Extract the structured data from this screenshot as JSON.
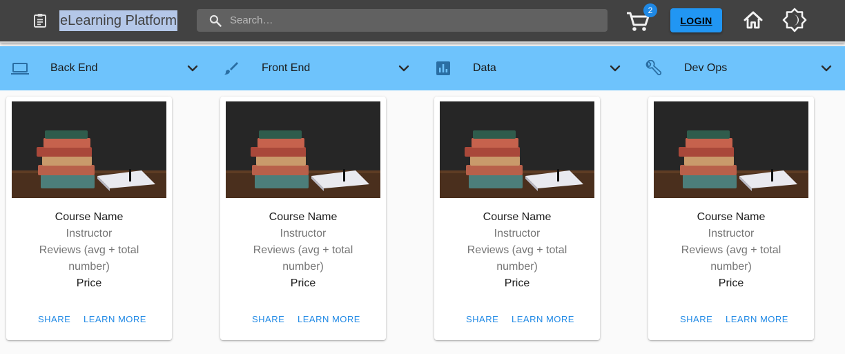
{
  "header": {
    "menu_icon": "clipboard-list-icon",
    "title": "eLearning Platform",
    "search": {
      "placeholder": "Search…",
      "value": "",
      "icon": "search-icon"
    },
    "cart": {
      "icon": "cart-icon",
      "count": "2"
    },
    "login_label": "LOGIN",
    "home_icon": "home-icon",
    "theme_icon": "brightness-icon",
    "colors": {
      "bar": "#424242",
      "accent": "#2196f3",
      "badge": "#1e88e5"
    }
  },
  "categories": {
    "background": "#6ec3fc",
    "items": [
      {
        "label": "Back End",
        "icon": "laptop-icon"
      },
      {
        "label": "Front End",
        "icon": "brush-icon"
      },
      {
        "label": "Data",
        "icon": "bar-chart-icon"
      },
      {
        "label": "Dev Ops",
        "icon": "wrench-icon"
      }
    ]
  },
  "courses": [
    {
      "name": "Course Name",
      "instructor": "Instructor",
      "reviews": "Reviews (avg + total number)",
      "price": "Price",
      "share": "SHARE",
      "learn_more": "LEARN MORE"
    },
    {
      "name": "Course Name",
      "instructor": "Instructor",
      "reviews": "Reviews (avg + total number)",
      "price": "Price",
      "share": "SHARE",
      "learn_more": "LEARN MORE"
    },
    {
      "name": "Course Name",
      "instructor": "Instructor",
      "reviews": "Reviews (avg + total number)",
      "price": "Price",
      "share": "SHARE",
      "learn_more": "LEARN MORE"
    },
    {
      "name": "Course Name",
      "instructor": "Instructor",
      "reviews": "Reviews (avg + total number)",
      "price": "Price",
      "share": "SHARE",
      "learn_more": "LEARN MORE"
    }
  ]
}
